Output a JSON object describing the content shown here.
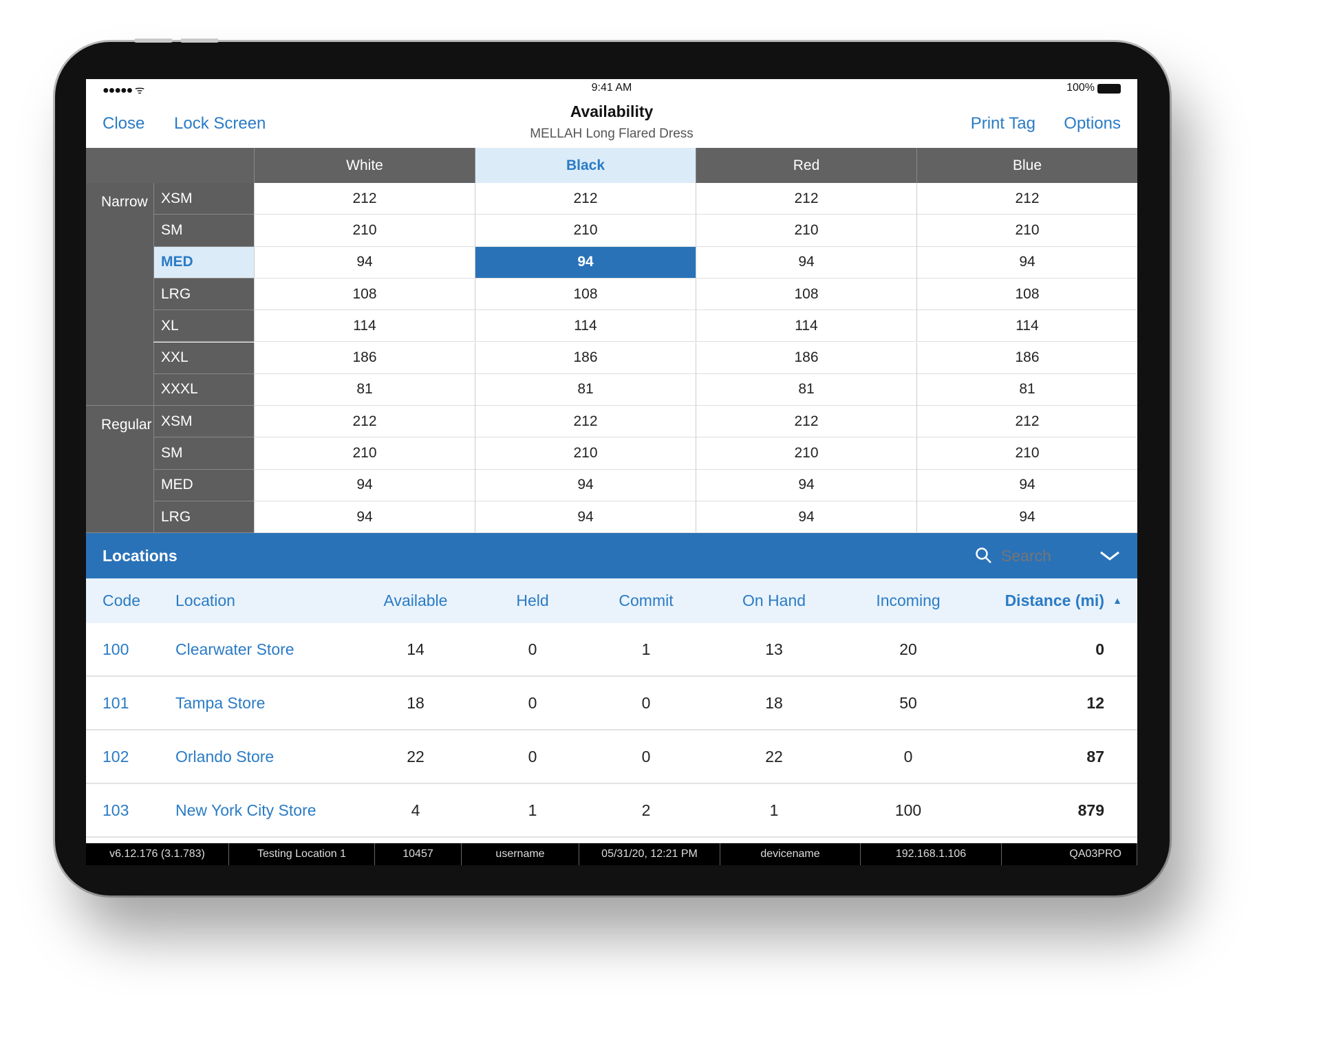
{
  "status": {
    "time": "9:41 AM",
    "battery": "100%"
  },
  "nav": {
    "close": "Close",
    "lock": "Lock Screen",
    "title": "Availability",
    "subtitle": "MELLAH Long Flared Dress",
    "print": "Print Tag",
    "options": "Options"
  },
  "colors": [
    "White",
    "Black",
    "Red",
    "Blue"
  ],
  "selected": {
    "color": "Black",
    "group": "Narrow",
    "size": "MED"
  },
  "groups": [
    {
      "name": "Narrow",
      "rows": [
        {
          "size": "XSM",
          "values": [
            "212",
            "212",
            "212",
            "212"
          ]
        },
        {
          "size": "SM",
          "values": [
            "210",
            "210",
            "210",
            "210"
          ]
        },
        {
          "size": "MED",
          "values": [
            "94",
            "94",
            "94",
            "94"
          ]
        },
        {
          "size": "LRG",
          "values": [
            "108",
            "108",
            "108",
            "108"
          ]
        },
        {
          "size": "XL",
          "values": [
            "114",
            "114",
            "114",
            "114"
          ]
        },
        {
          "size": "XXL",
          "values": [
            "186",
            "186",
            "186",
            "186"
          ]
        },
        {
          "size": "XXXL",
          "values": [
            "81",
            "81",
            "81",
            "81"
          ]
        }
      ]
    },
    {
      "name": "Regular",
      "rows": [
        {
          "size": "XSM",
          "values": [
            "212",
            "212",
            "212",
            "212"
          ]
        },
        {
          "size": "SM",
          "values": [
            "210",
            "210",
            "210",
            "210"
          ]
        },
        {
          "size": "MED",
          "values": [
            "94",
            "94",
            "94",
            "94"
          ]
        },
        {
          "size": "LRG",
          "values": [
            "94",
            "94",
            "94",
            "94"
          ]
        }
      ]
    }
  ],
  "locations": {
    "title": "Locations",
    "search_placeholder": "Search",
    "columns": [
      "Code",
      "Location",
      "Available",
      "Held",
      "Commit",
      "On Hand",
      "Incoming",
      "Distance (mi)"
    ],
    "sort": "Distance (mi) ascending",
    "rows": [
      [
        "100",
        "Clearwater Store",
        "14",
        "0",
        "1",
        "13",
        "20",
        "0"
      ],
      [
        "101",
        "Tampa Store",
        "18",
        "0",
        "0",
        "18",
        "50",
        "12"
      ],
      [
        "102",
        "Orlando Store",
        "22",
        "0",
        "0",
        "22",
        "0",
        "87"
      ],
      [
        "103",
        "New York City Store",
        "4",
        "1",
        "2",
        "1",
        "100",
        "879"
      ]
    ]
  },
  "footer": [
    "v6.12.176 (3.1.783)",
    "Testing Location 1",
    "10457",
    "username",
    "05/31/20, 12:21 PM",
    "devicename",
    "192.168.1.106",
    "QA03PRO"
  ],
  "accent": "#2a72b8"
}
